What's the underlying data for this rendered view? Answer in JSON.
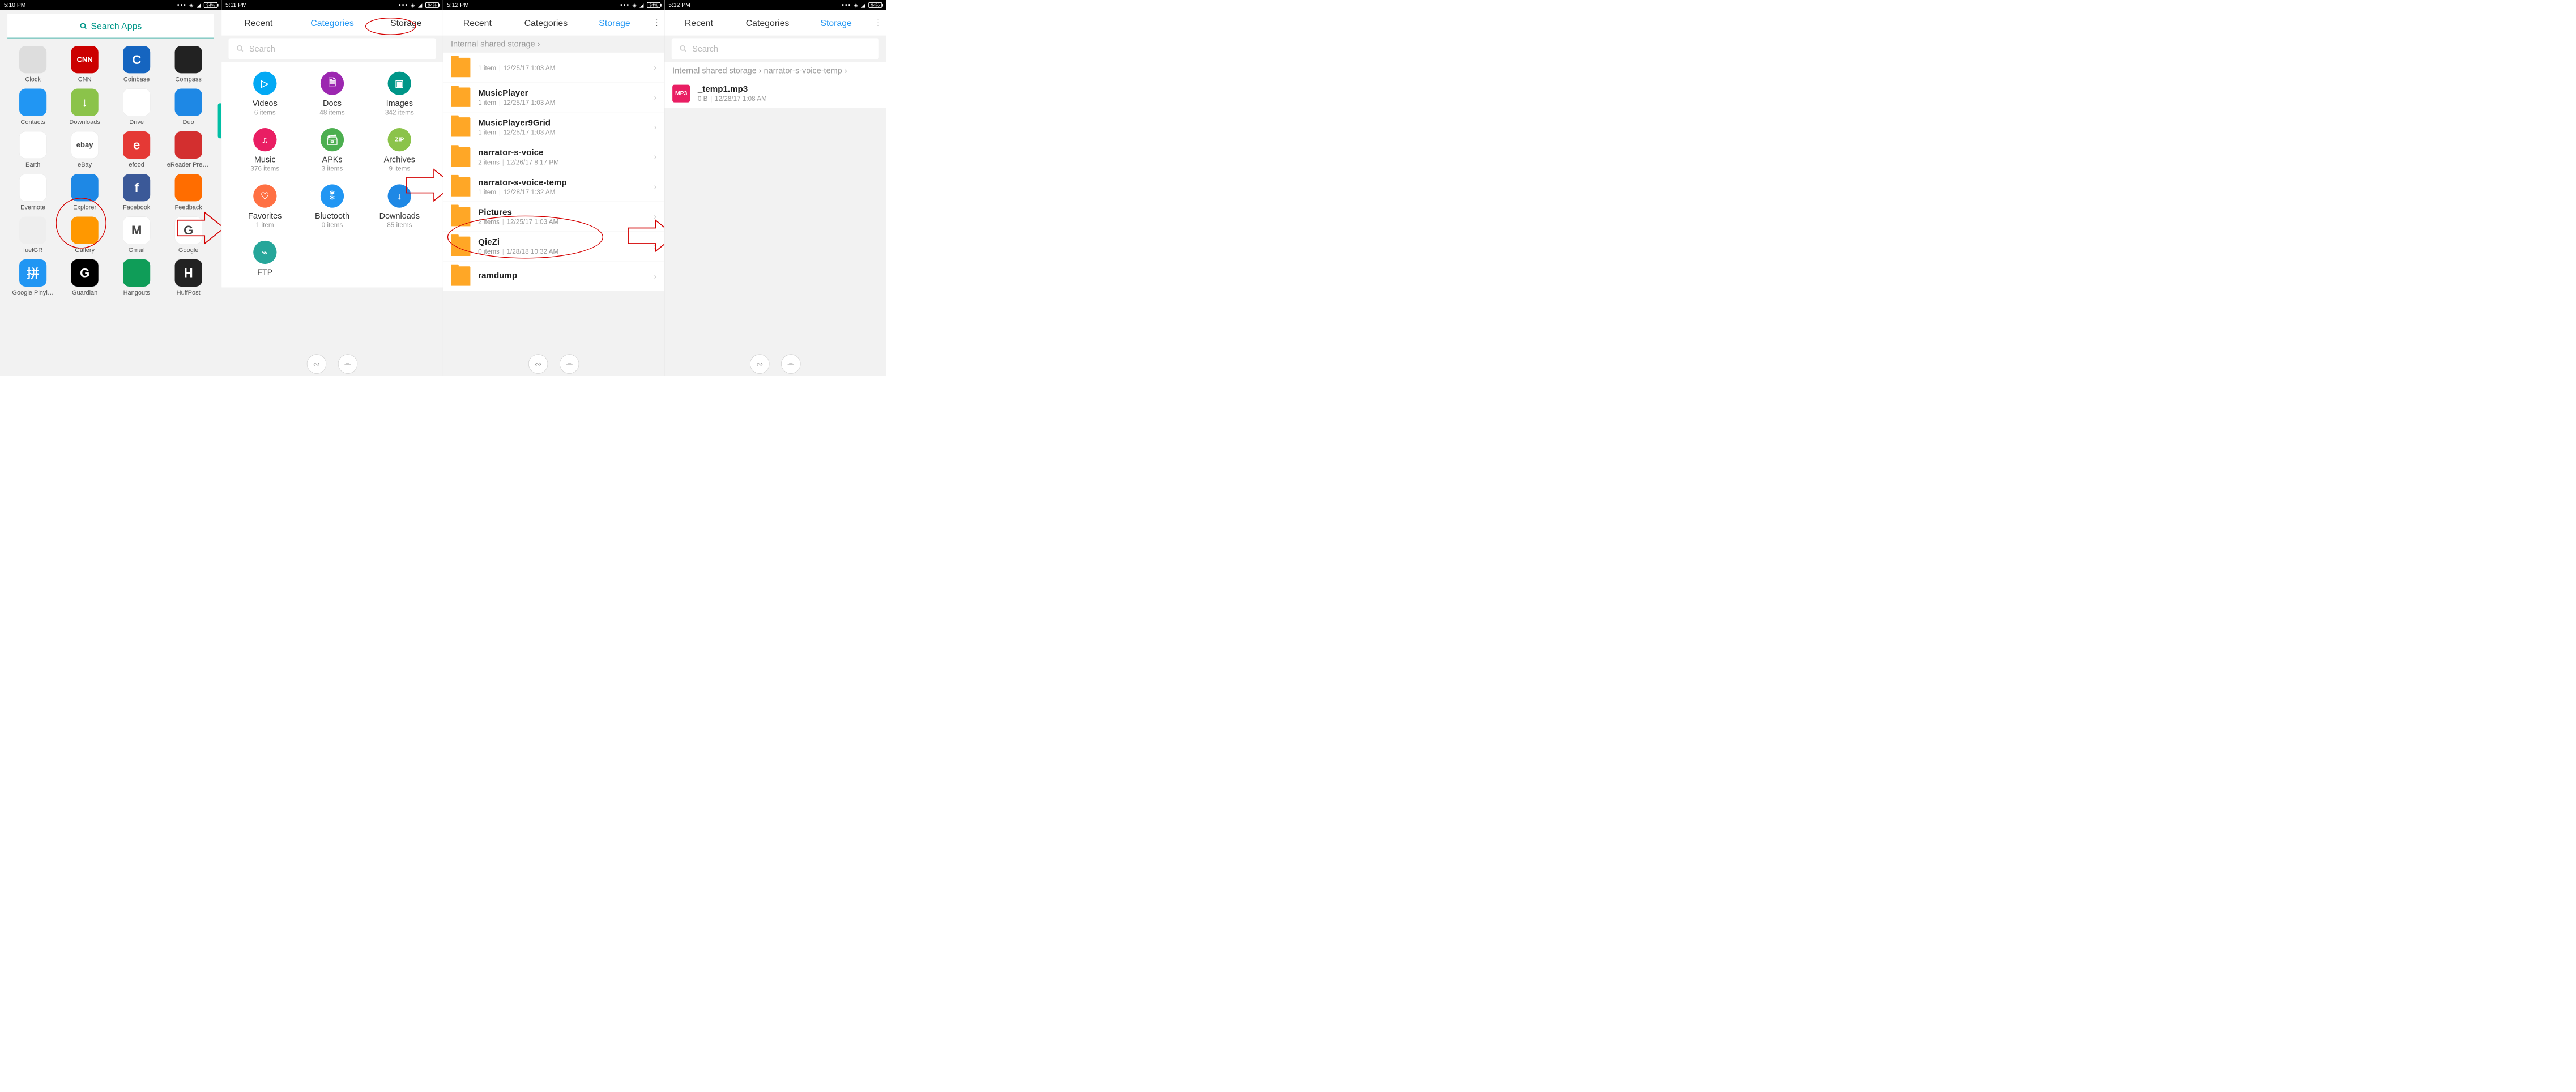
{
  "status": {
    "battery": "94%"
  },
  "screen1": {
    "time": "5:10 PM",
    "search_label": "Search Apps",
    "apps": [
      {
        "label": "Clock",
        "bg": "#ddd"
      },
      {
        "label": "CNN",
        "bg": "#cc0000",
        "text": "CNN"
      },
      {
        "label": "Coinbase",
        "bg": "#1565c0",
        "text": "C"
      },
      {
        "label": "Compass",
        "bg": "#222"
      },
      {
        "label": "Contacts",
        "bg": "#2196f3"
      },
      {
        "label": "Downloads",
        "bg": "#8bc34a",
        "text": "↓"
      },
      {
        "label": "Drive",
        "bg": "#fff"
      },
      {
        "label": "Duo",
        "bg": "#1e88e5"
      },
      {
        "label": "Earth",
        "bg": "#fff"
      },
      {
        "label": "eBay",
        "bg": "#fff",
        "text": "ebay"
      },
      {
        "label": "efood",
        "bg": "#e53935",
        "text": "e"
      },
      {
        "label": "eReader Pres…",
        "bg": "#d32f2f"
      },
      {
        "label": "Evernote",
        "bg": "#fff"
      },
      {
        "label": "Explorer",
        "bg": "#1e88e5"
      },
      {
        "label": "Facebook",
        "bg": "#3b5998",
        "text": "f"
      },
      {
        "label": "Feedback",
        "bg": "#ff6d00"
      },
      {
        "label": "fuelGR",
        "bg": "#eee"
      },
      {
        "label": "Gallery",
        "bg": "#ff9800"
      },
      {
        "label": "Gmail",
        "bg": "#fff",
        "text": "M"
      },
      {
        "label": "Google",
        "bg": "#fff",
        "text": "G"
      },
      {
        "label": "Google Pinyi…",
        "bg": "#2196f3",
        "text": "拼"
      },
      {
        "label": "Guardian",
        "bg": "#000",
        "text": "G"
      },
      {
        "label": "Hangouts",
        "bg": "#0f9d58"
      },
      {
        "label": "HuffPost",
        "bg": "#222",
        "text": "H"
      }
    ]
  },
  "screen2": {
    "time": "5:11 PM",
    "tabs": {
      "recent": "Recent",
      "categories": "Categories",
      "storage": "Storage"
    },
    "search_placeholder": "Search",
    "cats": [
      {
        "label": "Videos",
        "sub": "6 items",
        "bg": "#03a9f4",
        "icon": "▷"
      },
      {
        "label": "Docs",
        "sub": "48 items",
        "bg": "#9c27b0",
        "icon": "🗎"
      },
      {
        "label": "Images",
        "sub": "342 items",
        "bg": "#009688",
        "icon": "▣"
      },
      {
        "label": "Music",
        "sub": "376 items",
        "bg": "#e91e63",
        "icon": "♫"
      },
      {
        "label": "APKs",
        "sub": "3 items",
        "bg": "#4caf50",
        "icon": "🗃"
      },
      {
        "label": "Archives",
        "sub": "9 items",
        "bg": "#8bc34a",
        "icon": "ZIP"
      },
      {
        "label": "Favorites",
        "sub": "1 item",
        "bg": "#ff7043",
        "icon": "♡"
      },
      {
        "label": "Bluetooth",
        "sub": "0 items",
        "bg": "#2196f3",
        "icon": "⁑"
      },
      {
        "label": "Downloads",
        "sub": "85 items",
        "bg": "#1e88e5",
        "icon": "↓"
      },
      {
        "label": "FTP",
        "sub": "",
        "bg": "#26a69a",
        "icon": "⌁"
      }
    ]
  },
  "screen3": {
    "time": "5:12 PM",
    "tabs": {
      "recent": "Recent",
      "categories": "Categories",
      "storage": "Storage"
    },
    "breadcrumb": "Internal shared storage",
    "folders": [
      {
        "name": "",
        "sub_count": "1 item",
        "sub_date": "12/25/17 1:03 AM"
      },
      {
        "name": "MusicPlayer",
        "sub_count": "1 item",
        "sub_date": "12/25/17 1:03 AM"
      },
      {
        "name": "MusicPlayer9Grid",
        "sub_count": "1 item",
        "sub_date": "12/25/17 1:03 AM"
      },
      {
        "name": "narrator-s-voice",
        "sub_count": "2 items",
        "sub_date": "12/26/17 8:17 PM"
      },
      {
        "name": "narrator-s-voice-temp",
        "sub_count": "1 item",
        "sub_date": "12/28/17 1:32 AM"
      },
      {
        "name": "Pictures",
        "sub_count": "2 items",
        "sub_date": "12/25/17 1:03 AM"
      },
      {
        "name": "QieZi",
        "sub_count": "0 items",
        "sub_date": "1/28/18 10:32 AM"
      },
      {
        "name": "ramdump",
        "sub_count": "",
        "sub_date": ""
      }
    ]
  },
  "screen4": {
    "time": "5:12 PM",
    "tabs": {
      "recent": "Recent",
      "categories": "Categories",
      "storage": "Storage"
    },
    "search_placeholder": "Search",
    "breadcrumb_a": "Internal shared storage",
    "breadcrumb_b": "narrator-s-voice-temp",
    "file": {
      "name": "_temp1.mp3",
      "size": "0 B",
      "date": "12/28/17 1:08 AM",
      "badge": "MP3"
    }
  }
}
